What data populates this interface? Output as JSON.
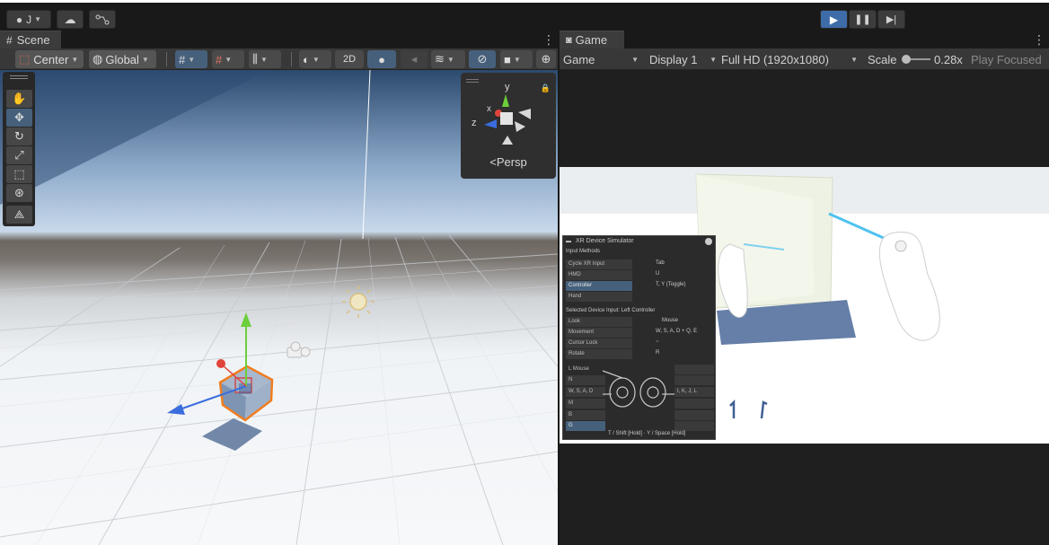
{
  "top_toolbar": {
    "account_label": "J",
    "play_state": "playing"
  },
  "scene": {
    "tab_label": "Scene",
    "pivot_mode": "Center",
    "pivot_rotation": "Global",
    "two_d_label": "2D",
    "gizmo_projection_label": "Persp",
    "gizmo_axes": {
      "y": "y",
      "x": "x",
      "z": "z"
    }
  },
  "game": {
    "tab_label": "Game",
    "view_dropdown": "Game",
    "display_dropdown": "Display 1",
    "resolution_dropdown": "Full HD (1920x1080)",
    "scale_label": "Scale",
    "scale_value": "0.28x",
    "play_focused": "Play Focused"
  },
  "xr_simulator": {
    "title": "XR Device Simulator",
    "input_methods_header": "Input Methods",
    "methods": [
      {
        "label": "Cycle XR Input",
        "key": "Tab"
      },
      {
        "label": "HMD",
        "key": "U"
      },
      {
        "label": "Controller",
        "key": "T, Y (Toggle)"
      },
      {
        "label": "Hand",
        "key": ""
      }
    ],
    "selected_header": "Selected Device Input: Left Controller",
    "inputs": [
      {
        "label": "Look",
        "key": "Mouse"
      },
      {
        "label": "Movement",
        "key": "W, S, A, D + Q, E"
      },
      {
        "label": "Cursor Lock",
        "key": "~"
      },
      {
        "label": "Rotate",
        "key": "R"
      }
    ],
    "controller_keys": [
      "L Mouse",
      "N",
      "W, S, A, D",
      "M",
      "B",
      "G"
    ],
    "right_keys": [
      "I, K, J, L"
    ],
    "footer": "T / Shift [Hold] · Y / Space [Hold]"
  },
  "colors": {
    "accent_blue": "#3e6ca8",
    "selected_tool": "#46607c",
    "panel_bg": "#383838",
    "axis_x": "#e0443a",
    "axis_y": "#6dcf3b",
    "axis_z": "#3a6ddd",
    "selection_outline": "#f07d1f"
  }
}
